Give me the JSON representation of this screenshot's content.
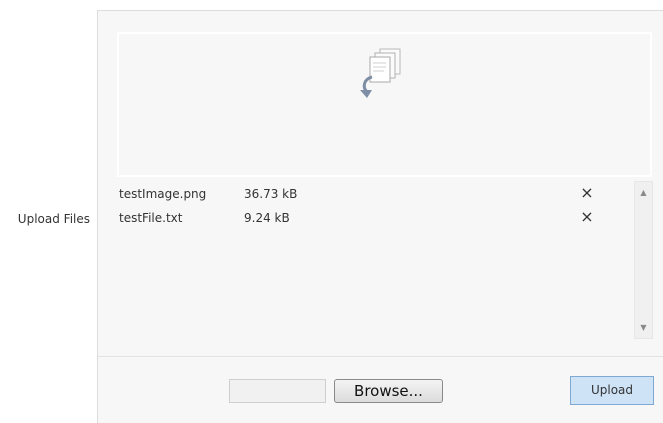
{
  "form": {
    "label": "Upload Files"
  },
  "dropzone": {
    "icon": "file-drop-icon"
  },
  "files": [
    {
      "name": "testImage.png",
      "size": "36.73 kB",
      "remove_icon": "×"
    },
    {
      "name": "testFile.txt",
      "size": "9.24 kB",
      "remove_icon": "×"
    }
  ],
  "scrollbar": {
    "up": "▲",
    "down": "▼"
  },
  "footer": {
    "browse_label": "Browse...",
    "upload_label": "Upload"
  }
}
